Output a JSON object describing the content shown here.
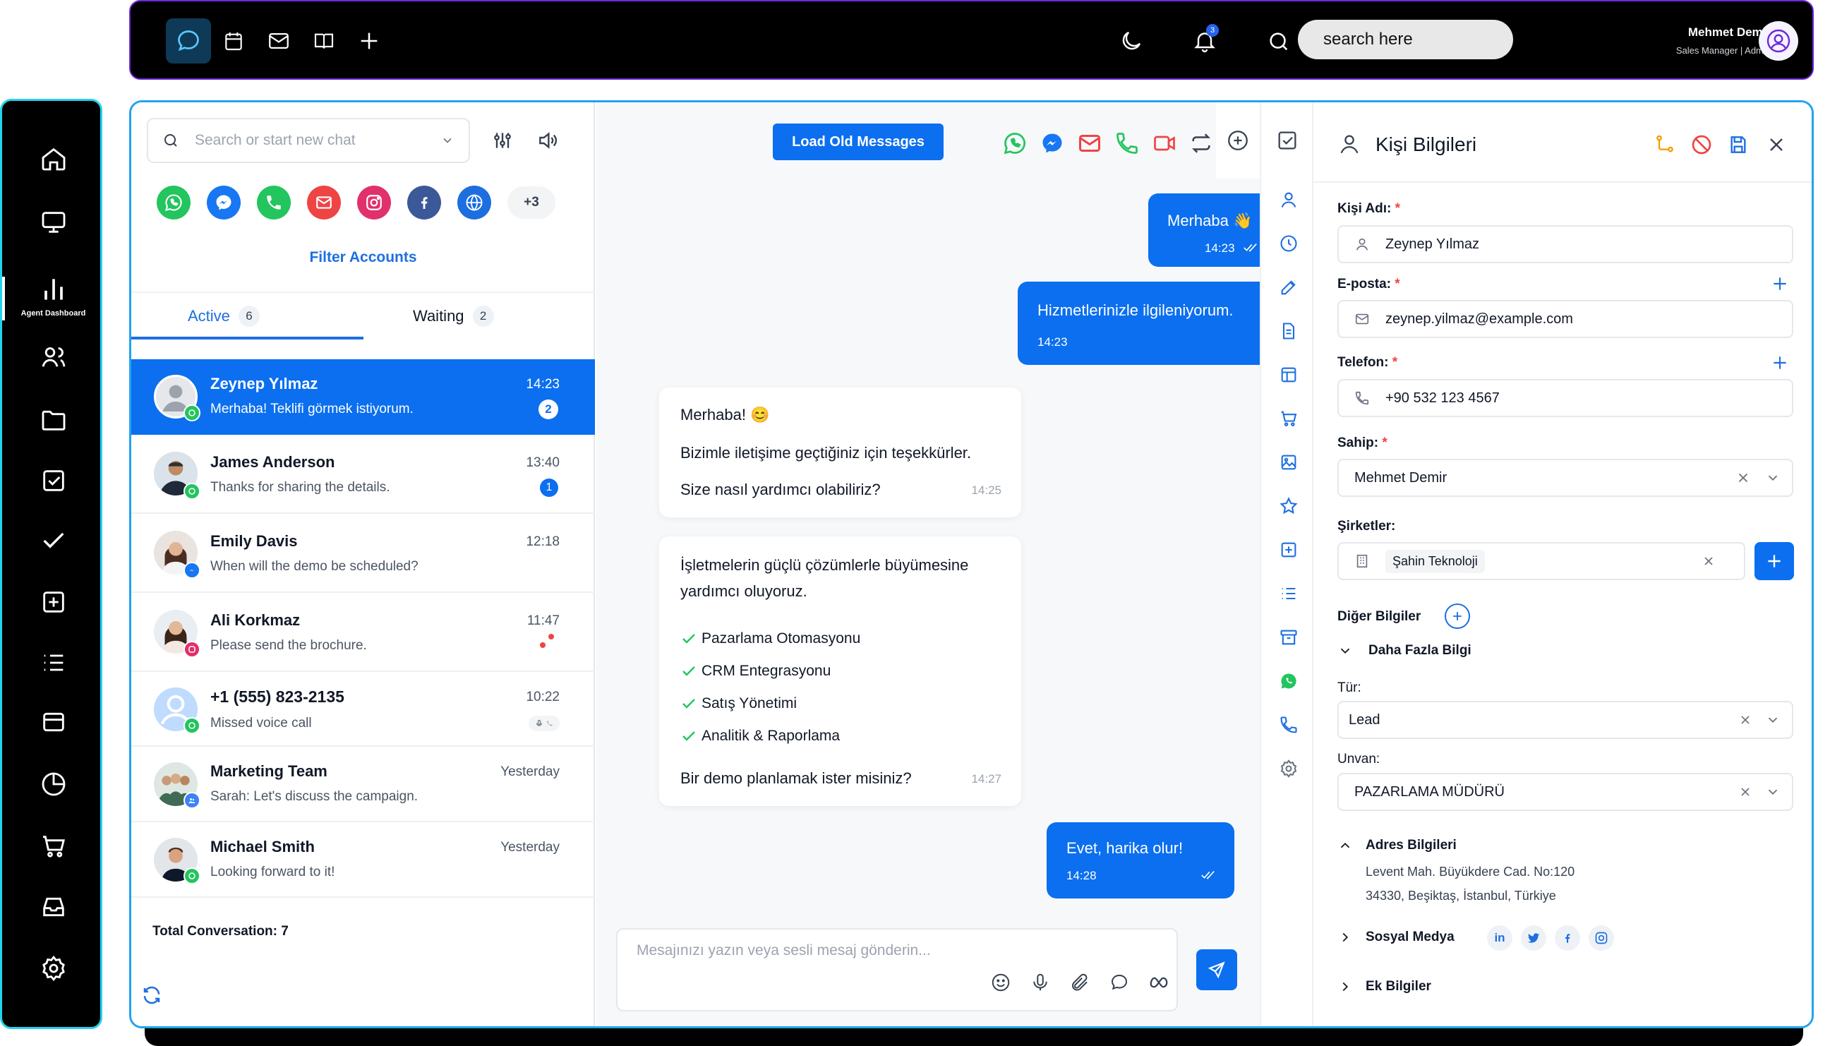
{
  "header": {
    "search_placeholder": "search here",
    "user_name": "Mehmet Demir",
    "user_role": "Sales Manager | Admin",
    "notification_count": "3"
  },
  "sidebar": {
    "active_label": "Agent Dashboard"
  },
  "chat_list": {
    "search_placeholder": "Search or start new chat",
    "more_accounts": "+3",
    "filter_accounts": "Filter Accounts",
    "tabs": [
      {
        "label": "Active",
        "count": "6"
      },
      {
        "label": "Waiting",
        "count": "2"
      }
    ],
    "conversations": [
      {
        "name": "Zeynep Yılmaz",
        "message": "Merhaba! Teklifi görmek istiyorum.",
        "time": "14:23",
        "unread": "2",
        "channel": "whatsapp"
      },
      {
        "name": "James Anderson",
        "message": "Thanks for sharing the details.",
        "time": "13:40",
        "unread": "1",
        "channel": "whatsapp"
      },
      {
        "name": "Emily Davis",
        "message": "When will the demo be scheduled?",
        "time": "12:18",
        "unread": "",
        "channel": "messenger"
      },
      {
        "name": "Ali Korkmaz",
        "message": "Please send the brochure.",
        "time": "11:47",
        "unread": "",
        "channel": "instagram"
      },
      {
        "name": "+1 (555) 823-2135",
        "message": "Missed voice call",
        "time": "10:22",
        "unread": "",
        "channel": "whatsapp"
      },
      {
        "name": "Marketing Team",
        "message": "Sarah: Let's discuss the campaign.",
        "time": "Yesterday",
        "unread": "",
        "channel": "group"
      },
      {
        "name": "Michael Smith",
        "message": "Looking forward to it!",
        "time": "Yesterday",
        "unread": "",
        "channel": "whatsapp"
      }
    ],
    "total": "Total Conversation: 7"
  },
  "chat": {
    "load_old": "Load Old Messages",
    "messages": [
      {
        "dir": "out",
        "text": "Merhaba 👋",
        "time": "14:23"
      },
      {
        "dir": "out",
        "text": "Hizmetlerinizle ilgileniyorum.",
        "time": "14:23"
      },
      {
        "dir": "in",
        "lines": [
          "Merhaba! 😊",
          "Bizimle iletişime geçtiğiniz için teşekkürler.",
          "Size nasıl yardımcı olabiliriz?"
        ],
        "time": "14:25"
      },
      {
        "dir": "in",
        "intro": "İşletmelerin güçlü çözümlerle büyümesine yardımcı oluyoruz.",
        "items": [
          "Pazarlama Otomasyonu",
          "CRM Entegrasyonu",
          "Satış Yönetimi",
          "Analitik & Raporlama"
        ],
        "outro": "Bir demo planlamak ister misiniz?",
        "time": "14:27"
      },
      {
        "dir": "out",
        "text": "Evet, harika olur!",
        "time": "14:28"
      }
    ],
    "composer_placeholder": "Mesajınızı yazın veya sesli mesaj gönderin..."
  },
  "contact": {
    "title": "Kişi Bilgileri",
    "name_label": "Kişi Adı:",
    "name_value": "Zeynep Yılmaz",
    "email_label": "E-posta:",
    "email_value": "zeynep.yilmaz@example.com",
    "phone_label": "Telefon:",
    "phone_value": "+90 532 123 4567",
    "owner_label": "Sahip:",
    "owner_value": "Mehmet Demir",
    "companies_label": "Şirketler:",
    "company_tag": "Şahin Teknoloji",
    "other_label": "Diğer Bilgiler",
    "more_info": "Daha Fazla Bilgi",
    "type_label": "Tür:",
    "type_value": "Lead",
    "title_label": "Unvan:",
    "title_value": "PAZARLAMA MÜDÜRÜ",
    "address_label": "Adres Bilgileri",
    "address_line1": "Levent Mah. Büyükdere Cad. No:120",
    "address_line2": "34330, Beşiktaş, İstanbul, Türkiye",
    "social_label": "Sosyal Medya",
    "extra_label": "Ek Bilgiler"
  },
  "colors": {
    "primary": "#0b6ff0",
    "whatsapp": "#22c55e",
    "messenger": "#1877f2",
    "mail": "#ef4444",
    "instagram": "#e1306c"
  }
}
